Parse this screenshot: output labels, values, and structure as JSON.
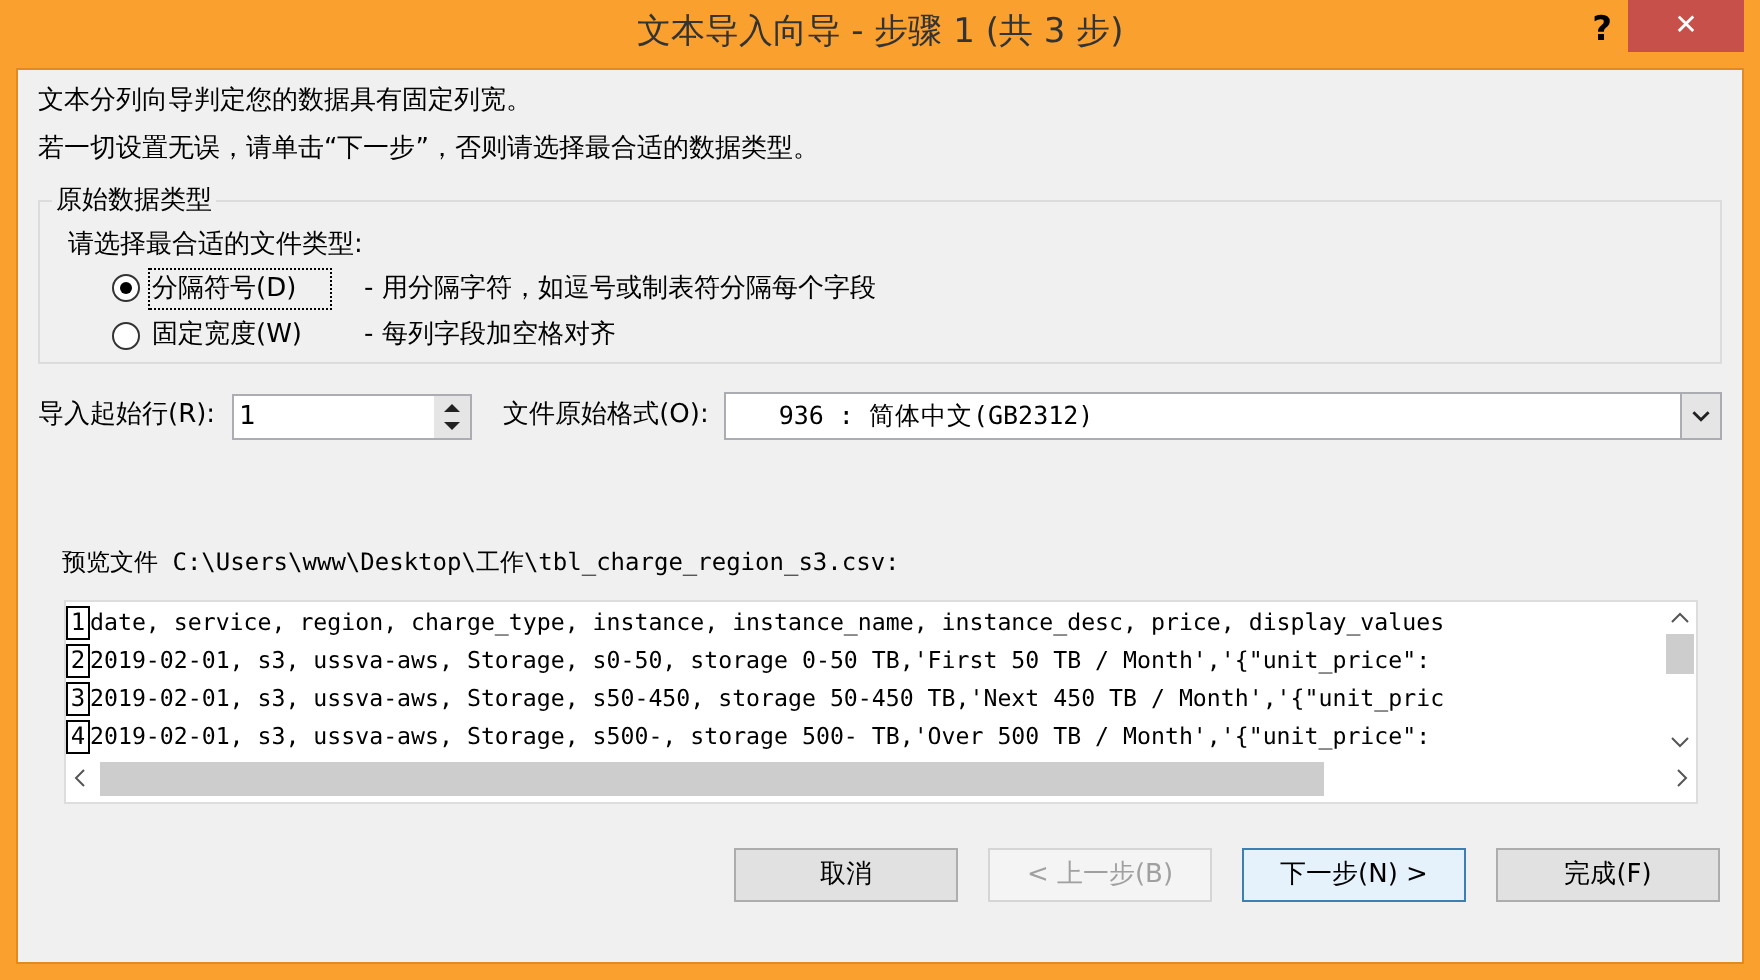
{
  "window": {
    "title": "文本导入向导 - 步骤 1 (共 3 步)",
    "help": "?",
    "close": "✕"
  },
  "intro": [
    "文本分列向导判定您的数据具有固定列宽。",
    "若一切设置无误，请单击“下一步”，否则请选择最合适的数据类型。"
  ],
  "group": {
    "title": "原始数据类型",
    "prompt": "请选择最合适的文件类型:",
    "options": [
      {
        "label": "分隔符号(D)",
        "desc": "- 用分隔字符，如逗号或制表符分隔每个字段",
        "selected": true
      },
      {
        "label": "固定宽度(W)",
        "desc": "- 每列字段加空格对齐",
        "selected": false
      }
    ]
  },
  "start_row": {
    "label": "导入起始行(R):",
    "value": "1"
  },
  "file_origin": {
    "label": "文件原始格式(O):",
    "value": "936 : 简体中文(GB2312)"
  },
  "preview": {
    "label": "预览文件 C:\\Users\\www\\Desktop\\工作\\tbl_charge_region_s3.csv:",
    "rows": [
      {
        "number": "1",
        "text": "date, service, region, charge_type, instance, instance_name, instance_desc, price, display_values"
      },
      {
        "number": "2",
        "text": "2019-02-01, s3, ussva-aws, Storage, s0-50, storage 0-50 TB,'First 50 TB / Month','{\"unit_price\":"
      },
      {
        "number": "3",
        "text": "2019-02-01, s3, ussva-aws, Storage, s50-450, storage 50-450 TB,'Next 450 TB / Month','{\"unit_pric"
      },
      {
        "number": "4",
        "text": "2019-02-01, s3, ussva-aws, Storage, s500-, storage 500- TB,'Over 500 TB / Month','{\"unit_price\":"
      }
    ]
  },
  "buttons": [
    {
      "label": "取消",
      "disabled": false,
      "default": false
    },
    {
      "label": "< 上一步(B)",
      "disabled": true,
      "default": false
    },
    {
      "label": "下一步(N) >",
      "disabled": false,
      "default": true
    },
    {
      "label": "完成(F)",
      "disabled": false,
      "default": false
    }
  ]
}
